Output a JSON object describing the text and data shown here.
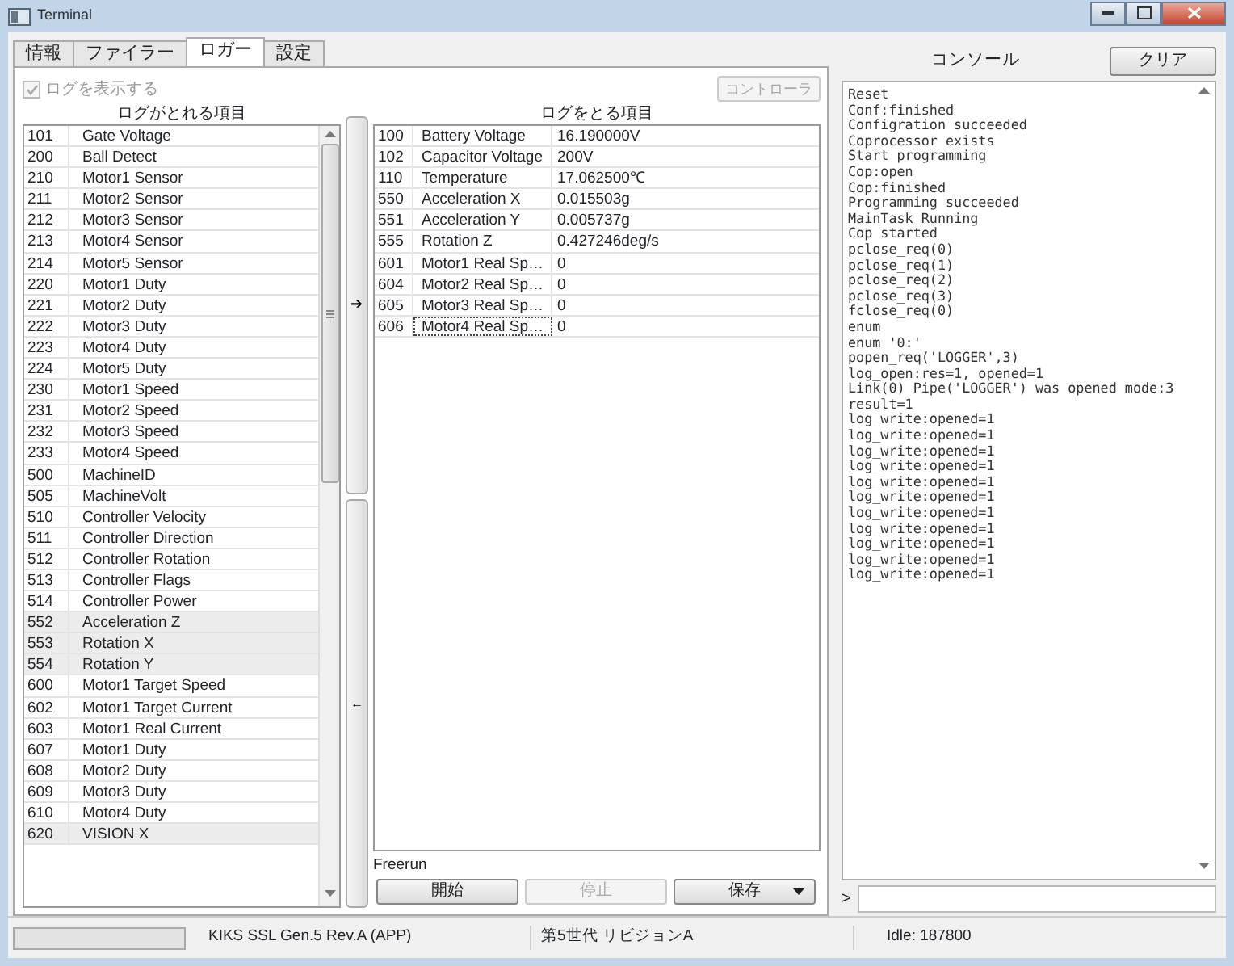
{
  "window": {
    "title": "Terminal"
  },
  "tabs": [
    {
      "label": "情報",
      "selected": false
    },
    {
      "label": "ファイラー",
      "selected": false
    },
    {
      "label": "ロガー",
      "selected": true
    },
    {
      "label": "設定",
      "selected": false
    }
  ],
  "show_log": {
    "label": "ログを表示する",
    "checked": true,
    "disabled": true
  },
  "controller_button": {
    "label": "コントローラ",
    "disabled": true
  },
  "available": {
    "heading": "ログがとれる項目",
    "items": [
      {
        "id": "101",
        "name": "Gate Voltage",
        "highlighted": false
      },
      {
        "id": "200",
        "name": "Ball Detect",
        "highlighted": false
      },
      {
        "id": "210",
        "name": "Motor1 Sensor",
        "highlighted": false
      },
      {
        "id": "211",
        "name": "Motor2 Sensor",
        "highlighted": false
      },
      {
        "id": "212",
        "name": "Motor3 Sensor",
        "highlighted": false
      },
      {
        "id": "213",
        "name": "Motor4 Sensor",
        "highlighted": false
      },
      {
        "id": "214",
        "name": "Motor5 Sensor",
        "highlighted": false
      },
      {
        "id": "220",
        "name": "Motor1 Duty",
        "highlighted": false
      },
      {
        "id": "221",
        "name": "Motor2 Duty",
        "highlighted": false
      },
      {
        "id": "222",
        "name": "Motor3 Duty",
        "highlighted": false
      },
      {
        "id": "223",
        "name": "Motor4 Duty",
        "highlighted": false
      },
      {
        "id": "224",
        "name": "Motor5 Duty",
        "highlighted": false
      },
      {
        "id": "230",
        "name": "Motor1 Speed",
        "highlighted": false
      },
      {
        "id": "231",
        "name": "Motor2 Speed",
        "highlighted": false
      },
      {
        "id": "232",
        "name": "Motor3 Speed",
        "highlighted": false
      },
      {
        "id": "233",
        "name": "Motor4 Speed",
        "highlighted": false
      },
      {
        "id": "500",
        "name": "MachineID",
        "highlighted": false
      },
      {
        "id": "505",
        "name": "MachineVolt",
        "highlighted": false
      },
      {
        "id": "510",
        "name": "Controller Velocity",
        "highlighted": false
      },
      {
        "id": "511",
        "name": "Controller Direction",
        "highlighted": false
      },
      {
        "id": "512",
        "name": "Controller Rotation",
        "highlighted": false
      },
      {
        "id": "513",
        "name": "Controller Flags",
        "highlighted": false
      },
      {
        "id": "514",
        "name": "Controller Power",
        "highlighted": false
      },
      {
        "id": "552",
        "name": "Acceleration Z",
        "highlighted": true
      },
      {
        "id": "553",
        "name": "Rotation X",
        "highlighted": true
      },
      {
        "id": "554",
        "name": "Rotation Y",
        "highlighted": true
      },
      {
        "id": "600",
        "name": "Motor1 Target Speed",
        "highlighted": false
      },
      {
        "id": "602",
        "name": "Motor1 Target Current",
        "highlighted": false
      },
      {
        "id": "603",
        "name": "Motor1 Real Current",
        "highlighted": false
      },
      {
        "id": "607",
        "name": "Motor1 Duty",
        "highlighted": false
      },
      {
        "id": "608",
        "name": "Motor2 Duty",
        "highlighted": false
      },
      {
        "id": "609",
        "name": "Motor3 Duty",
        "highlighted": false
      },
      {
        "id": "610",
        "name": "Motor4 Duty",
        "highlighted": false
      },
      {
        "id": "620",
        "name": "VISION X",
        "highlighted": true
      }
    ]
  },
  "add_button": {
    "label": "➔"
  },
  "remove_button": {
    "label": "←"
  },
  "logged": {
    "heading": "ログをとる項目",
    "items": [
      {
        "id": "100",
        "name": "Battery Voltage",
        "value": "16.190000V",
        "focused": false
      },
      {
        "id": "102",
        "name": "Capacitor Voltage",
        "value": "200V",
        "focused": false
      },
      {
        "id": "110",
        "name": "Temperature",
        "value": "17.062500℃",
        "focused": false
      },
      {
        "id": "550",
        "name": "Acceleration X",
        "value": "0.015503g",
        "focused": false
      },
      {
        "id": "551",
        "name": "Acceleration Y",
        "value": "0.005737g",
        "focused": false
      },
      {
        "id": "555",
        "name": "Rotation Z",
        "value": "0.427246deg/s",
        "focused": false
      },
      {
        "id": "601",
        "name": "Motor1 Real Sp…",
        "value": "0",
        "focused": false
      },
      {
        "id": "604",
        "name": "Motor2 Real Sp…",
        "value": "0",
        "focused": false
      },
      {
        "id": "605",
        "name": "Motor3 Real Sp…",
        "value": "0",
        "focused": false
      },
      {
        "id": "606",
        "name": "Motor4 Real Sp…",
        "value": "0",
        "focused": true
      }
    ]
  },
  "mode": "Freerun",
  "actions": [
    {
      "label": "開始",
      "disabled": false,
      "dropdown": false
    },
    {
      "label": "停止",
      "disabled": true,
      "dropdown": false
    },
    {
      "label": "保存",
      "disabled": false,
      "dropdown": true
    }
  ],
  "console": {
    "title": "コンソール",
    "clear_button": "クリア",
    "prompt": ">",
    "lines": [
      "Reset",
      "Conf:finished",
      "Configration succeeded",
      "Coprocessor exists",
      "Start programming",
      "Cop:open",
      "Cop:finished",
      "Programming succeeded",
      "MainTask Running",
      "Cop started",
      "pclose_req(0)",
      "pclose_req(1)",
      "pclose_req(2)",
      "pclose_req(3)",
      "fclose_req(0)",
      "enum",
      "enum '0:'",
      "popen_req('LOGGER',3)",
      "log_open:res=1, opened=1",
      "Link(0) Pipe('LOGGER') was opened mode:3",
      "result=1",
      "log_write:opened=1",
      "log_write:opened=1",
      "log_write:opened=1",
      "log_write:opened=1",
      "log_write:opened=1",
      "log_write:opened=1",
      "log_write:opened=1",
      "log_write:opened=1",
      "log_write:opened=1",
      "log_write:opened=1",
      "log_write:opened=1"
    ]
  },
  "status_bar": {
    "progress": {
      "level": 0
    },
    "firmware": "KIKS SSL Gen.5 Rev.A (APP)",
    "revision": "第5世代 リビジョンA",
    "idle": "Idle: 187800"
  }
}
